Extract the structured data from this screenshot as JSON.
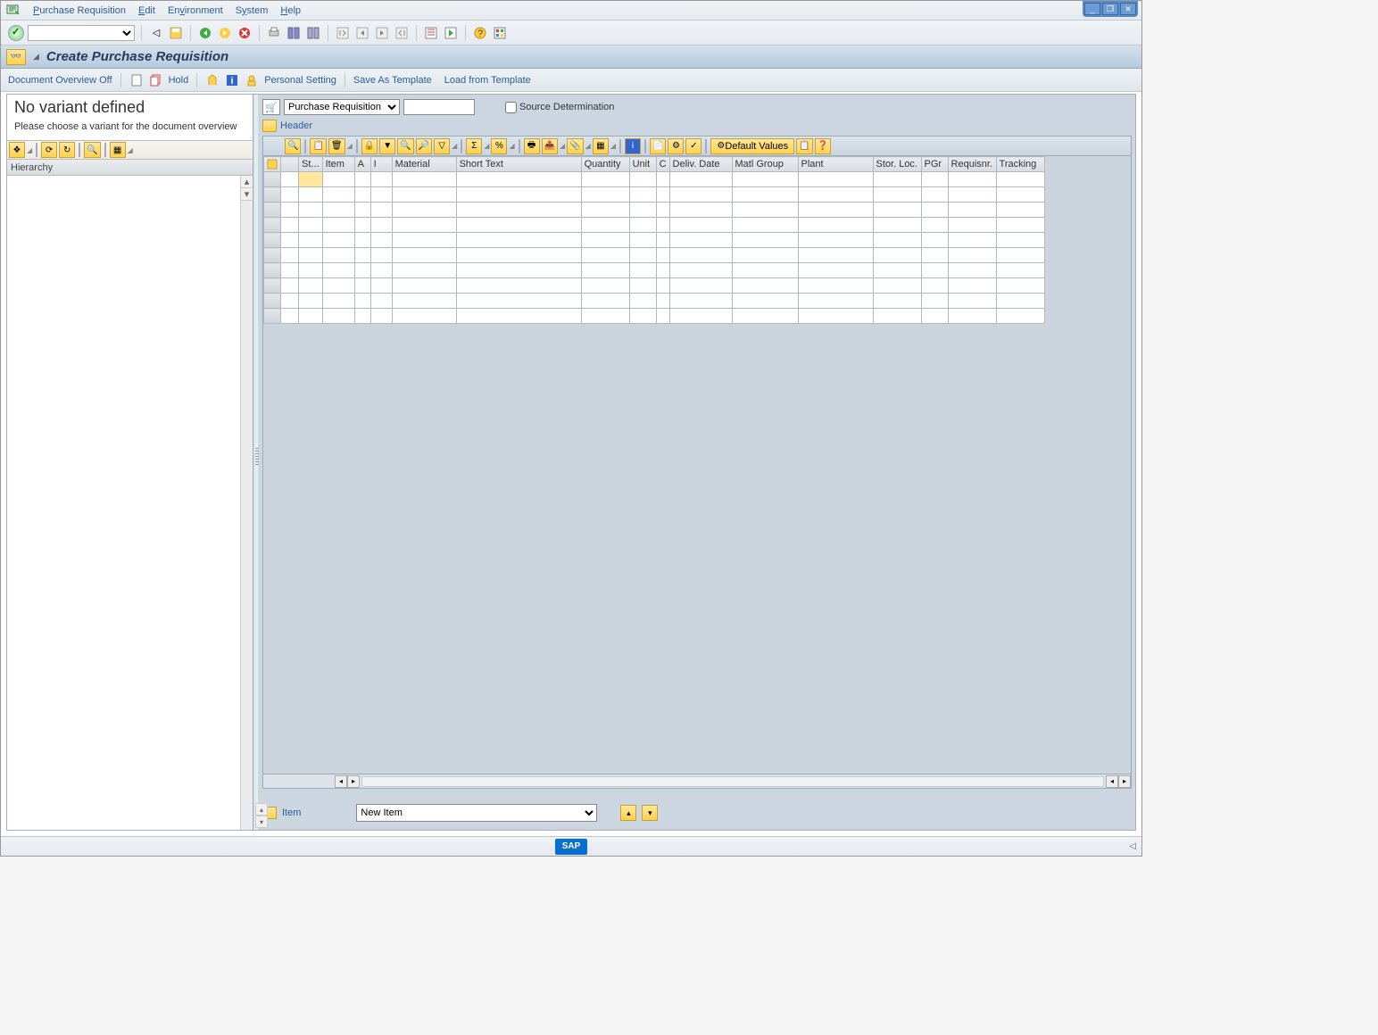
{
  "menu": {
    "items": [
      "Purchase Requisition",
      "Edit",
      "Environment",
      "System",
      "Help"
    ]
  },
  "title": "Create Purchase Requisition",
  "apptoolbar": {
    "doc_overview": "Document Overview Off",
    "hold": "Hold",
    "personal": "Personal Setting",
    "save_tpl": "Save As Template",
    "load_tpl": "Load from Template"
  },
  "left": {
    "title": "No variant defined",
    "msg": "Please choose a variant for the document overview",
    "hierarchy": "Hierarchy"
  },
  "doc": {
    "type": "Purchase Requisition",
    "number": "",
    "source_det": "Source Determination",
    "header": "Header"
  },
  "grid_toolbar": {
    "default_values": "Default Values"
  },
  "grid": {
    "cols": [
      "",
      "St...",
      "Item",
      "A",
      "I",
      "Material",
      "Short Text",
      "Quantity",
      "Unit",
      "C",
      "Deliv. Date",
      "Matl Group",
      "Plant",
      "Stor. Loc.",
      "PGr",
      "Requisnr.",
      "Tracking"
    ],
    "widths": [
      20,
      24,
      36,
      18,
      24,
      72,
      140,
      54,
      30,
      14,
      70,
      74,
      84,
      54,
      30,
      54,
      54
    ],
    "rows": 10
  },
  "item": {
    "label": "Item",
    "selected": "New Item"
  },
  "logo": "SAP"
}
